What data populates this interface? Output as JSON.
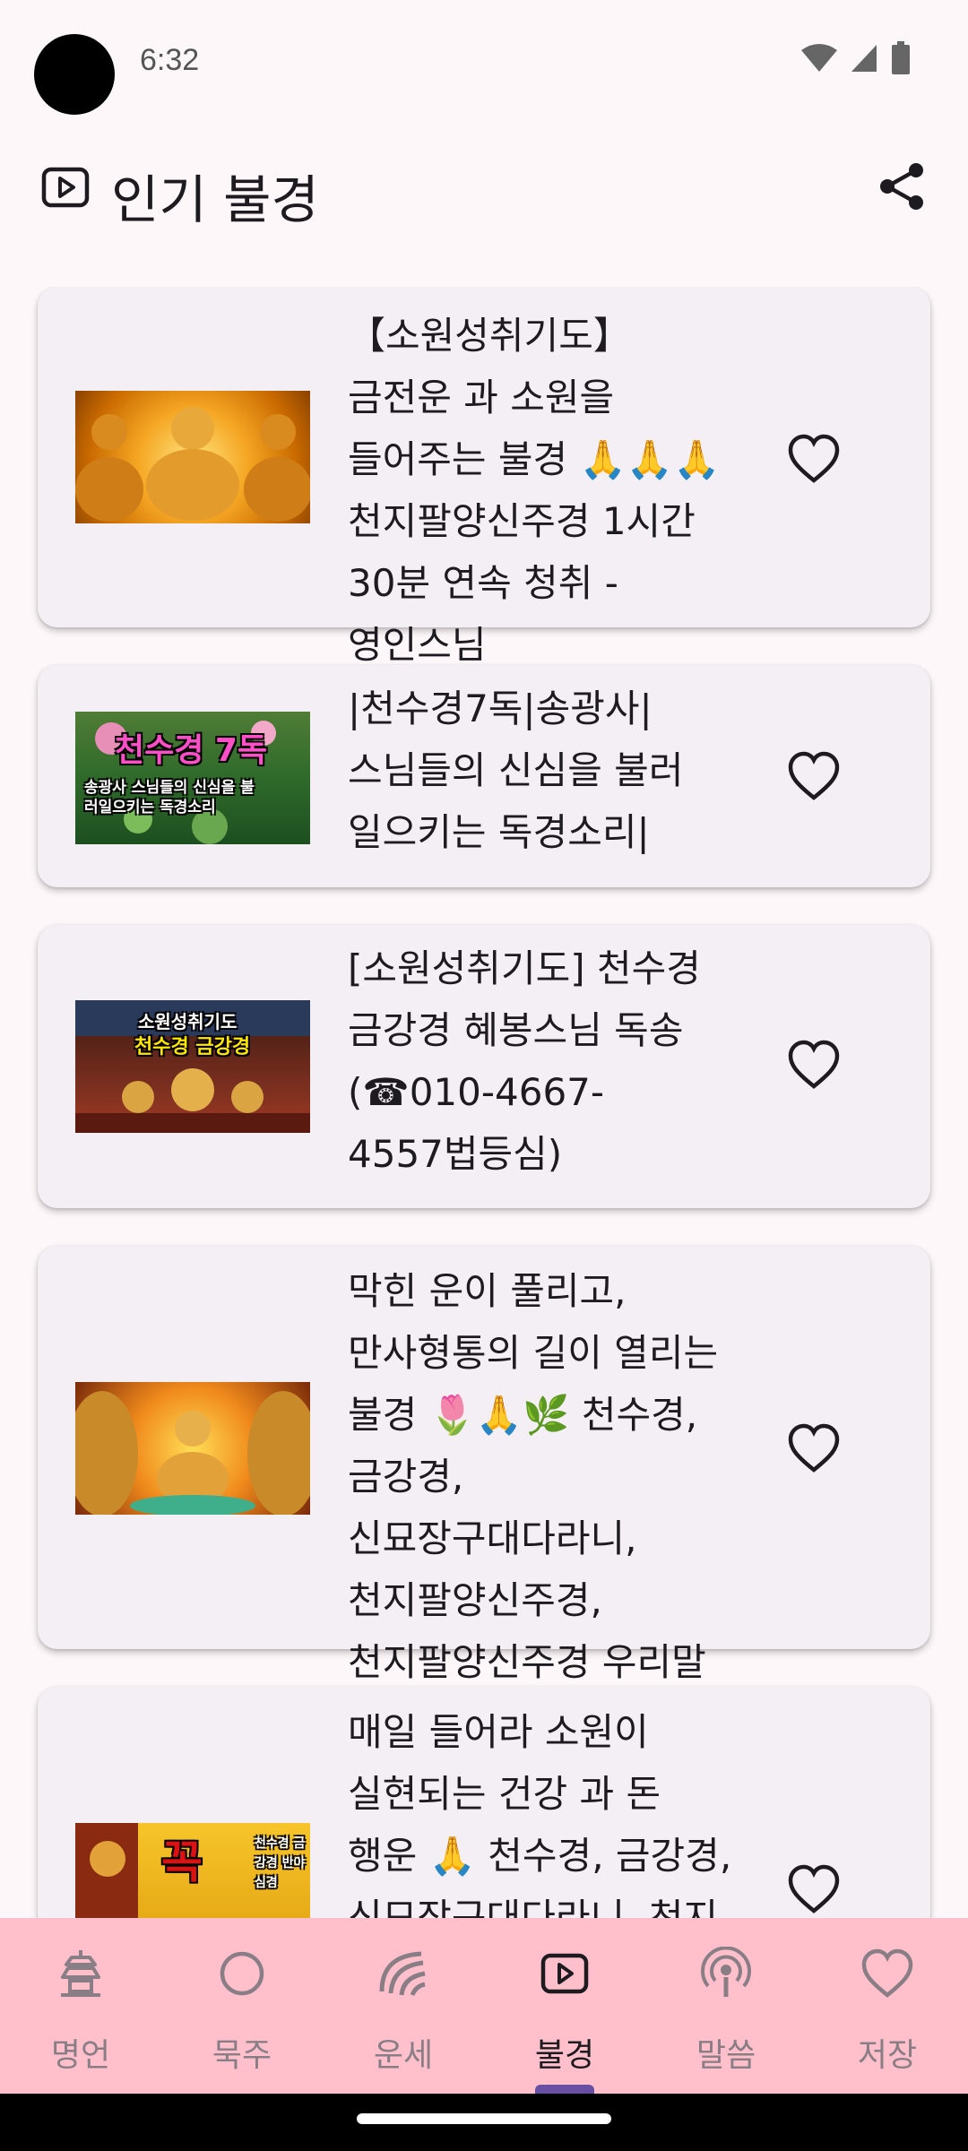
{
  "status_bar": {
    "time": "6:32"
  },
  "header": {
    "title": "인기 불경"
  },
  "items": [
    {
      "title": "【소원성취기도】금전운 과 소원을 들어주는 불경 🙏🙏🙏 천지팔양신주경 1시간 30분 연속 청취 - 영인스님",
      "thumb_text": ""
    },
    {
      "title": "|천수경7독|송광사|스님들의 신심을 불러 일으키는 독경소리|",
      "thumb_text": "천수경 7독",
      "thumb_sub": "송광사 스님들의 신심을 불러일으키는 독경소리"
    },
    {
      "title": "[소원성취기도] 천수경 금강경 혜봉스님 독송 (☎010-4667-4557법등심)",
      "thumb_text": "소원성취기도",
      "thumb_sub": "천수경 금강경"
    },
    {
      "title": "막힌 운이 풀리고, 만사형통의 길이 열리는 불경 🌷🙏🌿 천수경, 금강경, 신묘장구대다라니, 천지팔양신주경, 천지팔양신주경 우리말",
      "thumb_text": ""
    },
    {
      "title": "매일 들어라 소원이 실현되는 건강 과 돈 행운 🙏 천수경, 금강경, 신묘장구대다라니, 천지",
      "thumb_text": "꼭",
      "thumb_sub": "천수경 금강경 반야심경"
    }
  ],
  "nav": [
    {
      "label": "명언",
      "icon": "pagoda-icon"
    },
    {
      "label": "묵주",
      "icon": "circle-icon"
    },
    {
      "label": "운세",
      "icon": "fortune-icon"
    },
    {
      "label": "불경",
      "icon": "play-icon"
    },
    {
      "label": "말씀",
      "icon": "podcast-icon"
    },
    {
      "label": "저장",
      "icon": "heart-icon"
    }
  ],
  "active_nav": "불경",
  "colors": {
    "background": "#fef7fa",
    "card": "#f4eff4",
    "nav_bg": "#ffc0cb",
    "indicator": "#6750a4"
  }
}
